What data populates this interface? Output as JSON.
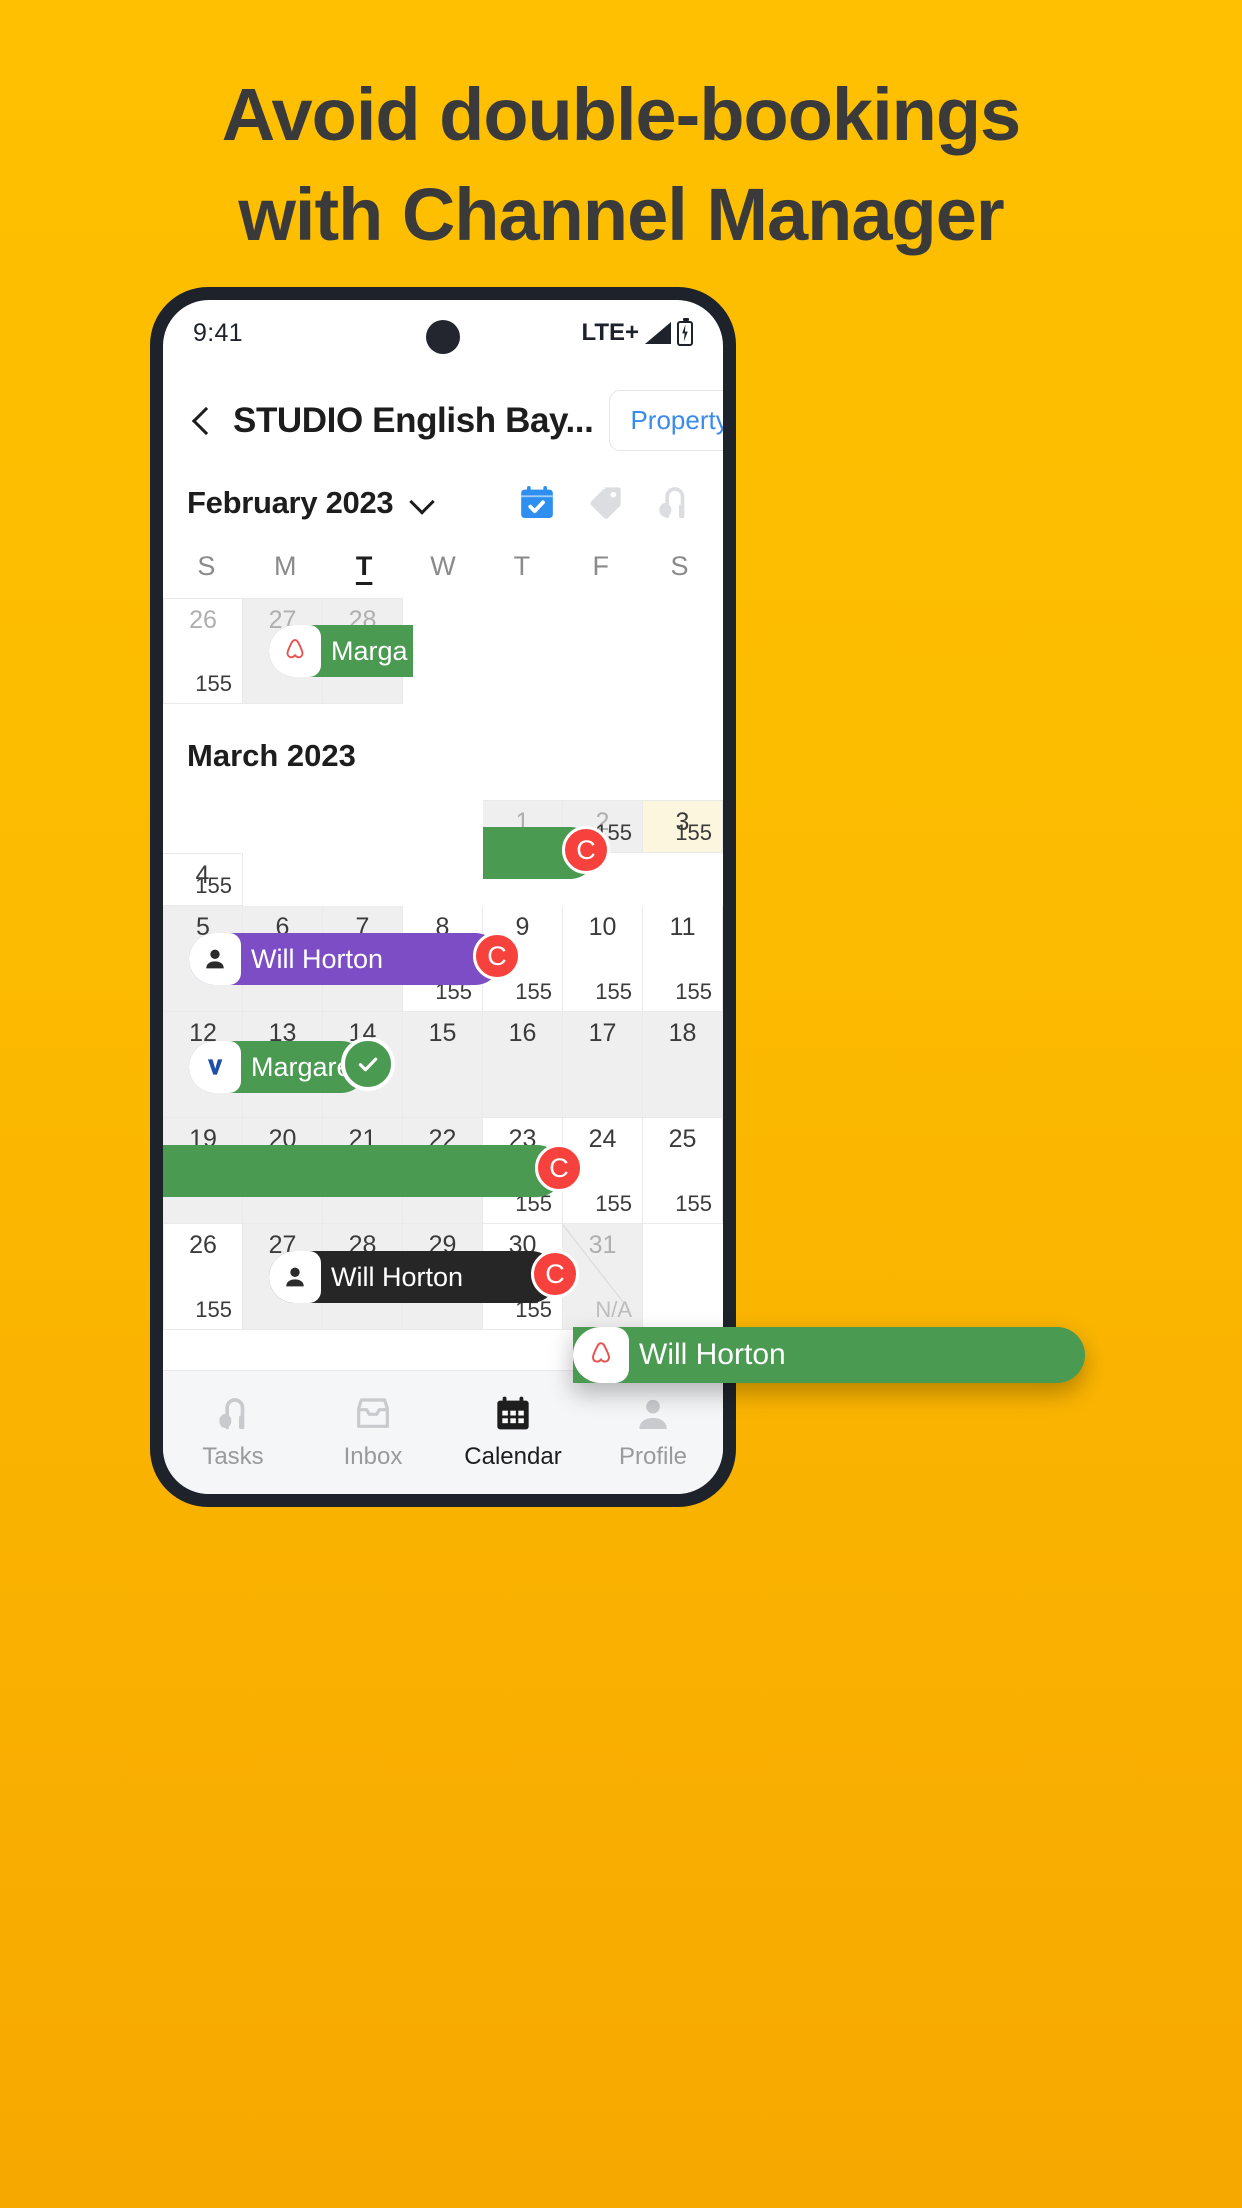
{
  "poster": {
    "headline_line1": "Avoid double-bookings",
    "headline_line2": "with Channel Manager",
    "background_color": "#FCB900"
  },
  "status_bar": {
    "time": "9:41",
    "network": "LTE+",
    "signal_icon": "signal-bars-icon",
    "battery_icon": "battery-charging-icon"
  },
  "app_header": {
    "back_icon": "chevron-left-icon",
    "title": "STUDIO English Bay...",
    "property_button": "Property",
    "property_button_color": "#3B8CEA"
  },
  "month_selector": {
    "label": "February 2023",
    "chevron_icon": "chevron-down-icon",
    "mode_icons": [
      {
        "name": "calendar-check-icon",
        "active": true,
        "color": "#2F8FF0"
      },
      {
        "name": "price-tag-icon",
        "active": false,
        "color": "#DCDDE0"
      },
      {
        "name": "vacuum-cleaner-icon",
        "active": false,
        "color": "#DCDDE0"
      }
    ]
  },
  "weekdays": [
    {
      "label": "S",
      "today": false
    },
    {
      "label": "M",
      "today": false
    },
    {
      "label": "T",
      "today": true
    },
    {
      "label": "W",
      "today": false
    },
    {
      "label": "T",
      "today": false
    },
    {
      "label": "F",
      "today": false
    },
    {
      "label": "S",
      "today": false
    }
  ],
  "february": {
    "heading": "February 2023",
    "days": [
      {
        "num": "26",
        "price": "155",
        "muted": true,
        "shaded": false
      },
      {
        "num": "27",
        "price": "",
        "muted": true,
        "shaded": true
      },
      {
        "num": "28",
        "price": "",
        "muted": true,
        "shaded": true
      }
    ],
    "booking": {
      "label": "Marga",
      "channel": "airbnb-icon",
      "color": "#4B9A52"
    }
  },
  "march": {
    "heading": "March 2023",
    "weeks": [
      {
        "days": [
          {
            "num": "",
            "price": "",
            "empty": true
          },
          {
            "num": "",
            "price": "",
            "empty": true
          },
          {
            "num": "",
            "price": "",
            "empty": true
          },
          {
            "num": "",
            "price": "",
            "empty": true
          },
          {
            "num": "1",
            "price": "",
            "muted": true,
            "shaded": true
          },
          {
            "num": "2",
            "price": "155",
            "muted": true,
            "shaded": true
          },
          {
            "num": "3",
            "price": "155",
            "today": true
          },
          {
            "num": "4",
            "price": "155"
          }
        ]
      },
      {
        "days": [
          {
            "num": "5",
            "price": "",
            "shaded": true
          },
          {
            "num": "6",
            "price": "",
            "shaded": true
          },
          {
            "num": "7",
            "price": "",
            "shaded": true
          },
          {
            "num": "8",
            "price": "155"
          },
          {
            "num": "9",
            "price": "155"
          },
          {
            "num": "10",
            "price": "155"
          },
          {
            "num": "11",
            "price": "155"
          }
        ]
      },
      {
        "days": [
          {
            "num": "12",
            "price": "",
            "shaded": true
          },
          {
            "num": "13",
            "price": "",
            "shaded": true
          },
          {
            "num": "14",
            "price": "",
            "shaded": true
          },
          {
            "num": "15",
            "price": "",
            "shaded": true
          },
          {
            "num": "16",
            "price": "",
            "shaded": true
          },
          {
            "num": "17",
            "price": "",
            "shaded": true
          },
          {
            "num": "18",
            "price": "",
            "shaded": true
          }
        ]
      },
      {
        "days": [
          {
            "num": "19",
            "price": "",
            "shaded": true
          },
          {
            "num": "20",
            "price": "",
            "shaded": true
          },
          {
            "num": "21",
            "price": "",
            "shaded": true
          },
          {
            "num": "22",
            "price": "",
            "shaded": true
          },
          {
            "num": "23",
            "price": "155"
          },
          {
            "num": "24",
            "price": "155"
          },
          {
            "num": "25",
            "price": "155"
          }
        ]
      },
      {
        "days": [
          {
            "num": "26",
            "price": "155"
          },
          {
            "num": "27",
            "price": "",
            "shaded": true
          },
          {
            "num": "28",
            "price": "",
            "shaded": true
          },
          {
            "num": "29",
            "price": "",
            "shaded": true
          },
          {
            "num": "30",
            "price": "155"
          },
          {
            "num": "31",
            "price": "N/A",
            "blocked": true,
            "shaded": true
          },
          {
            "num": "",
            "price": "",
            "empty": true
          }
        ]
      }
    ],
    "bookings": {
      "week1": {
        "label": "",
        "color": "#4B9A52",
        "end_badge": "C"
      },
      "week2": {
        "label": "Will Horton",
        "color": "#7C4DC4",
        "avatar": "person-icon",
        "end_badge": "C"
      },
      "week3_margaret": {
        "label": "Margaret",
        "color": "#4B9A52",
        "channel": "vrbo-icon",
        "check_badge": "check-icon"
      },
      "week3_will": {
        "label": "Will Horton",
        "color": "#4B9A52",
        "channel": "airbnb-icon",
        "dragging": true
      },
      "week4": {
        "label": "",
        "color": "#4B9A52",
        "end_badge": "C"
      },
      "week5": {
        "label": "Will Horton",
        "color": "#262626",
        "avatar": "person-icon",
        "end_badge": "C"
      }
    }
  },
  "bottom_nav": [
    {
      "label": "Tasks",
      "icon": "vacuum-cleaner-icon",
      "active": false
    },
    {
      "label": "Inbox",
      "icon": "inbox-tray-icon",
      "active": false
    },
    {
      "label": "Calendar",
      "icon": "calendar-icon",
      "active": true
    },
    {
      "label": "Profile",
      "icon": "person-icon",
      "active": false
    }
  ]
}
